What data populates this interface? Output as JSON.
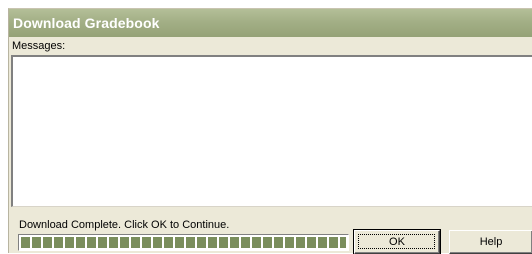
{
  "window": {
    "title": "Download Gradebook"
  },
  "messages": {
    "label": "Messages:",
    "content": ""
  },
  "status": {
    "text": "Download Complete.  Click OK to Continue."
  },
  "progress": {
    "percent": 100
  },
  "buttons": {
    "ok_label": "OK",
    "help_label": "Help"
  },
  "colors": {
    "titlebar": "#a3af86",
    "progress_fill": "#7a8e5c",
    "dialog_background": "#ece9d8"
  }
}
